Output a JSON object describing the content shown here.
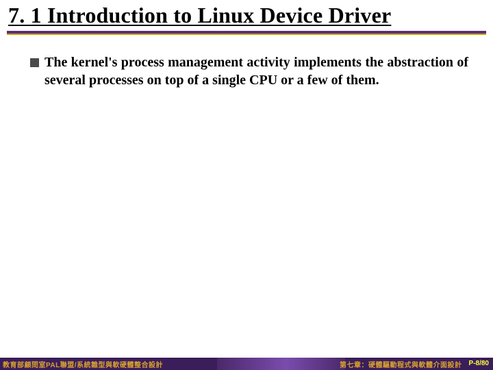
{
  "slide": {
    "title": "7. 1 Introduction to Linux Device Driver",
    "bullets": [
      {
        "text": "The kernel's process management activity implements the abstraction of several processes on top of a single CPU or a few of them."
      }
    ]
  },
  "footer": {
    "left": "教育部顧問室PAL聯盟/系統雛型與軟硬體整合設計",
    "right": "第七章：硬體驅動程式與軟體介面設計",
    "page": "P-8/80"
  }
}
